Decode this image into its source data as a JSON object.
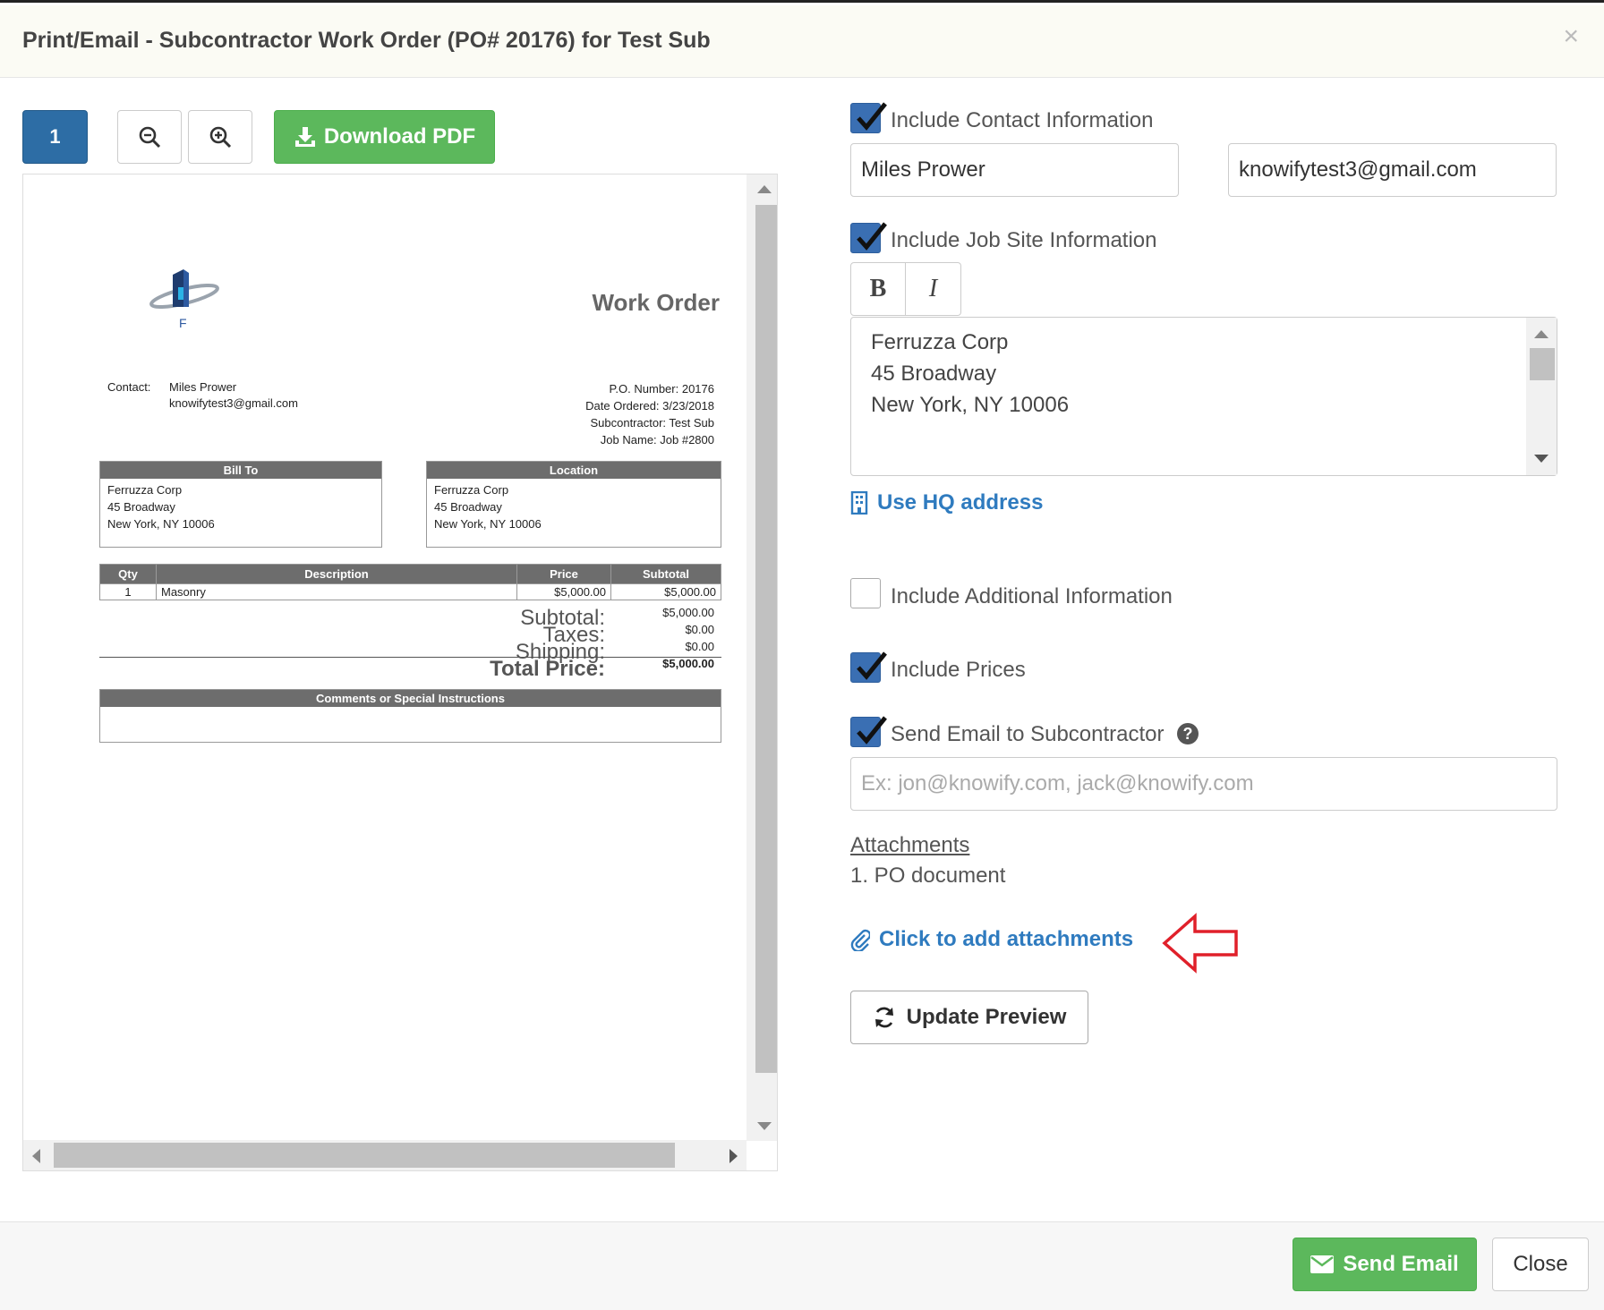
{
  "header": {
    "title": "Print/Email - Subcontractor Work Order (PO# 20176) for Test Sub",
    "close_glyph": "×"
  },
  "toolbar": {
    "page_label": "1",
    "download_label": "Download PDF",
    "zoom_out_icon": "zoom-out-icon",
    "zoom_in_icon": "zoom-in-icon"
  },
  "document": {
    "logo_letter": "F",
    "title": "Work Order",
    "contact_label": "Contact:",
    "contact_name": "Miles Prower",
    "contact_email": "knowifytest3@gmail.com",
    "meta": [
      "P.O. Number: 20176",
      "Date Ordered: 3/23/2018",
      "Subcontractor: Test Sub",
      "Job Name: Job #2800"
    ],
    "bill_to": {
      "header": "Bill To",
      "lines": [
        "Ferruzza Corp",
        "45 Broadway",
        "New York, NY 10006"
      ]
    },
    "location": {
      "header": "Location",
      "lines": [
        "Ferruzza Corp",
        "45 Broadway",
        "New York, NY 10006"
      ]
    },
    "items_table": {
      "headers": [
        "Qty",
        "Description",
        "Price",
        "Subtotal"
      ],
      "rows": [
        {
          "qty": "1",
          "description": "Masonry",
          "price": "$5,000.00",
          "subtotal": "$5,000.00"
        }
      ]
    },
    "totals": [
      {
        "label": "Subtotal:",
        "value": "$5,000.00"
      },
      {
        "label": "Taxes:",
        "value": "$0.00"
      },
      {
        "label": "Shipping:",
        "value": "$0.00"
      },
      {
        "label": "Total Price:",
        "value": "$5,000.00"
      }
    ],
    "comments_header": "Comments or Special Instructions"
  },
  "options": {
    "contact": {
      "label": "Include Contact Information",
      "checked": true,
      "name_value": "Miles Prower",
      "email_value": "knowifytest3@gmail.com"
    },
    "job_site": {
      "label": "Include Job Site Information",
      "checked": true,
      "bold_label": "B",
      "italic_label": "I",
      "address_lines": [
        "Ferruzza Corp",
        "45 Broadway",
        "New York, NY 10006"
      ],
      "hq_link": "Use HQ address"
    },
    "additional": {
      "label": "Include Additional Information",
      "checked": false
    },
    "prices": {
      "label": "Include Prices",
      "checked": true
    },
    "send_email": {
      "label": "Send Email to Subcontractor",
      "checked": true,
      "help_glyph": "?",
      "placeholder": "Ex: jon@knowify.com, jack@knowify.com"
    }
  },
  "attachments": {
    "heading": "Attachments",
    "items": [
      "1.  PO document"
    ],
    "add_link": "Click to add attachments"
  },
  "update_preview_label": "Update Preview",
  "footer": {
    "send_label": "Send Email",
    "close_label": "Close"
  },
  "colors": {
    "primary": "#2d6da5",
    "success": "#5cb85c",
    "link": "#2f7bbf",
    "annotation_arrow": "#e0202a"
  }
}
